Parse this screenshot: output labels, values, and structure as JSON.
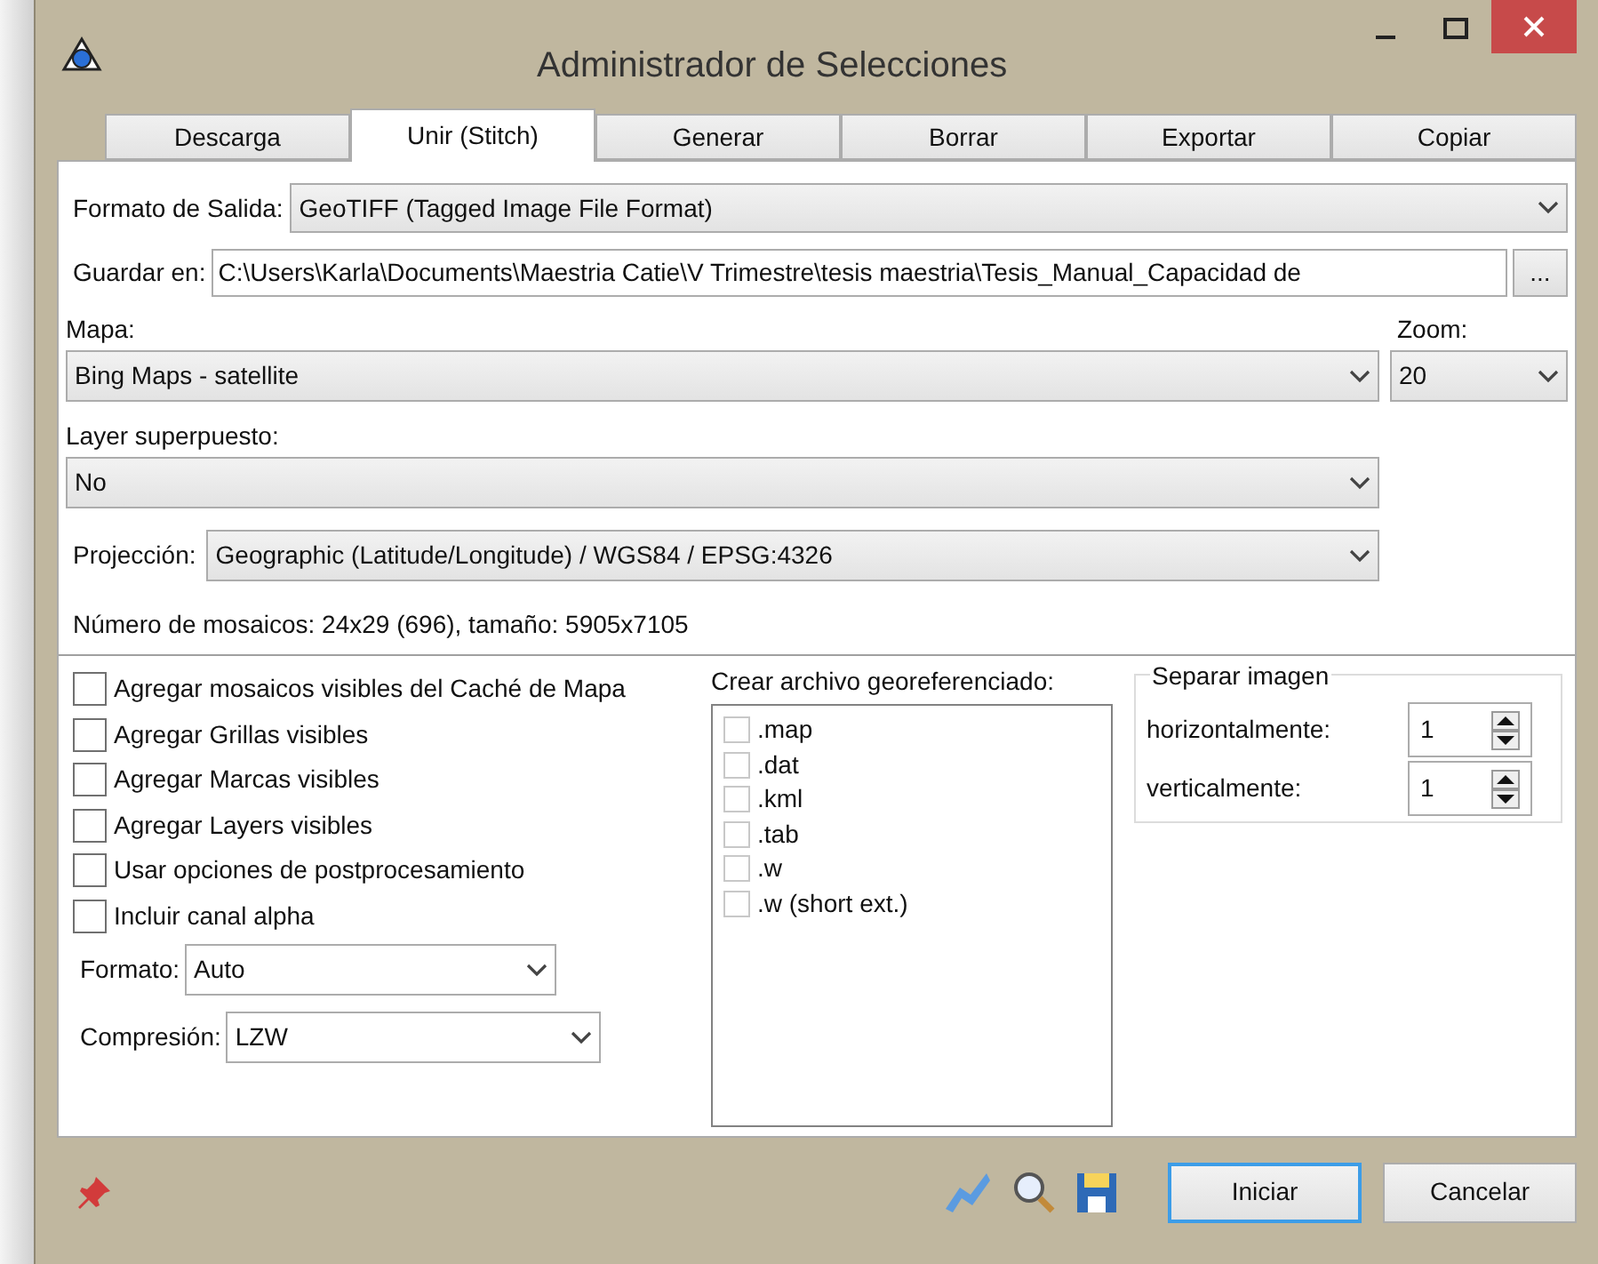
{
  "window": {
    "title": "Administrador de Selecciones"
  },
  "tabs": [
    {
      "label": "Descarga",
      "selected": false
    },
    {
      "label": "Unir (Stitch)",
      "selected": true
    },
    {
      "label": "Generar",
      "selected": false
    },
    {
      "label": "Borrar",
      "selected": false
    },
    {
      "label": "Exportar",
      "selected": false
    },
    {
      "label": "Copiar",
      "selected": false
    }
  ],
  "output_format": {
    "label": "Formato de Salida:",
    "value": "GeoTIFF (Tagged Image File Format)"
  },
  "save_in": {
    "label": "Guardar en:",
    "value": "C:\\Users\\Karla\\Documents\\Maestria Catie\\V Trimestre\\tesis maestria\\Tesis_Manual_Capacidad de",
    "browse": "..."
  },
  "map": {
    "label": "Mapa:",
    "value": "Bing Maps - satellite"
  },
  "zoom": {
    "label": "Zoom:",
    "value": "20"
  },
  "overlay": {
    "label": "Layer superpuesto:",
    "value": "No"
  },
  "projection": {
    "label": "Projección:",
    "value": "Geographic (Latitude/Longitude) / WGS84 / EPSG:4326"
  },
  "tile_info": "Número de mosaicos: 24x29 (696), tamaño: 5905x7105",
  "options": [
    {
      "label": "Agregar mosaicos visibles del Caché de Mapa",
      "checked": false
    },
    {
      "label": "Agregar Grillas visibles",
      "checked": false
    },
    {
      "label": "Agregar Marcas visibles",
      "checked": false
    },
    {
      "label": "Agregar Layers visibles",
      "checked": false
    },
    {
      "label": "Usar opciones de postprocesamiento",
      "checked": false
    },
    {
      "label": "Incluir canal alpha",
      "checked": false
    }
  ],
  "format": {
    "label": "Formato:",
    "value": "Auto"
  },
  "compression": {
    "label": "Compresión:",
    "value": "LZW"
  },
  "georef": {
    "label": "Crear archivo georeferenciado:",
    "items": [
      {
        "label": ".map",
        "checked": false
      },
      {
        "label": ".dat",
        "checked": false
      },
      {
        "label": ".kml",
        "checked": false
      },
      {
        "label": ".tab",
        "checked": false
      },
      {
        "label": ".w",
        "checked": false
      },
      {
        "label": ".w (short ext.)",
        "checked": false
      }
    ]
  },
  "split": {
    "title": "Separar imagen",
    "fields": [
      {
        "label": "horizontalmente:",
        "value": "1"
      },
      {
        "label": "verticalmente:",
        "value": "1"
      }
    ]
  },
  "buttons": [
    {
      "label": "Iniciar",
      "default": true
    },
    {
      "label": "Cancelar",
      "default": false
    }
  ]
}
